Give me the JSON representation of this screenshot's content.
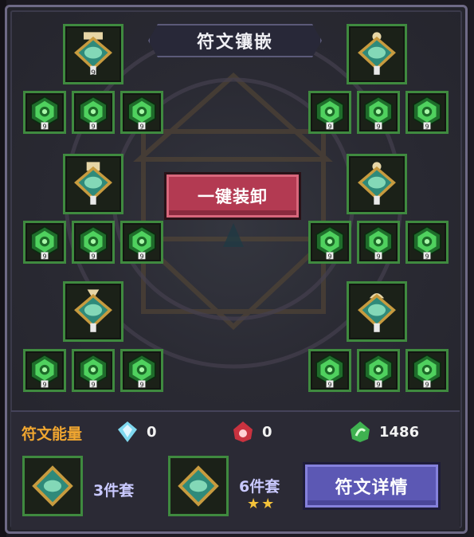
{
  "panel": {
    "title": "符文镶嵌",
    "unequip_label": "一键装卸"
  },
  "runes": {
    "main_icon": "spiral-rune-medallion-icon",
    "small_icons": [
      "leaf-rune-icon",
      "cross-rune-icon",
      "heart-rune-icon",
      "orb-rune-icon",
      "swirl-rune-icon",
      "dragon-rune-icon"
    ],
    "slot_levels": [
      "9"
    ]
  },
  "energy": {
    "label": "符文能量",
    "resources": [
      {
        "icon": "blue-crystal-icon",
        "value": "0"
      },
      {
        "icon": "red-flame-icon",
        "value": "0"
      },
      {
        "icon": "green-leaf-icon",
        "value": "1486"
      }
    ]
  },
  "sets": [
    {
      "label": "3件套",
      "stars": ""
    },
    {
      "label": "6件套",
      "stars": "★★"
    }
  ],
  "detail_label": "符文详情",
  "colors": {
    "slot_border": "#3f8a3f",
    "unequip_button": "#b33a52",
    "detail_button": "#5c58b4",
    "energy_label": "#f0a630",
    "star": "#f3c23a"
  }
}
